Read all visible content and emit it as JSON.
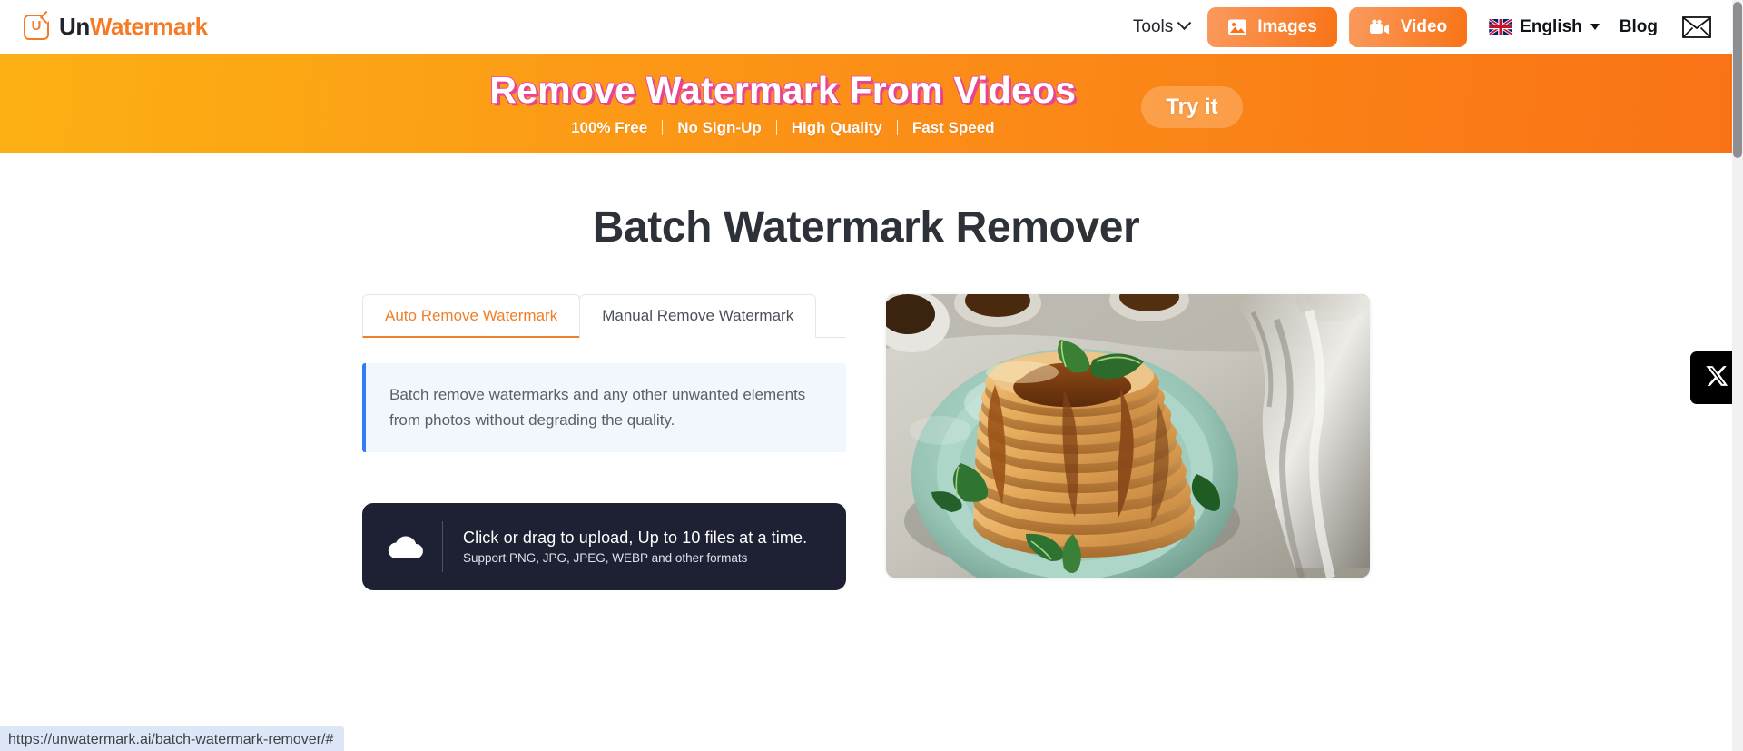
{
  "header": {
    "brand": {
      "prefix": "Un",
      "suffix": "Watermark",
      "mark_letter": "U",
      "icon": "logo-icon"
    },
    "tools_label": "Tools",
    "images_label": "Images",
    "video_label": "Video",
    "language_label": "English",
    "blog_label": "Blog",
    "mail_icon": "envelope-icon",
    "accent_orange": "#f97316",
    "brand_orange": "#f47b27"
  },
  "banner": {
    "title": "Remove Watermark From Videos",
    "features": [
      "100% Free",
      "No Sign-Up",
      "High Quality",
      "Fast Speed"
    ],
    "cta_label": "Try it",
    "gradient_start": "#fcb013",
    "gradient_end": "#f97316",
    "title_shadow_color": "#e8458f"
  },
  "main": {
    "page_title": "Batch Watermark Remover",
    "tabs": [
      {
        "label": "Auto Remove Watermark",
        "active": true
      },
      {
        "label": "Manual Remove Watermark",
        "active": false
      }
    ],
    "info_text": "Batch remove watermarks and any other unwanted elements from photos without degrading the quality.",
    "info_accent": "#2f7cf6",
    "upload": {
      "icon": "cloud-upload-icon",
      "primary": "Click or drag to upload, Up to 10 files at a time.",
      "secondary": "Support PNG, JPG, JPEG, WEBP and other formats",
      "background": "#1e2034"
    },
    "preview": {
      "alt": "stack of pancakes with syrup and mint on a teal plate",
      "plate_color": "#a7cfc4",
      "pancake_color": "#e8b162",
      "syrup_color": "#8a4318"
    }
  },
  "floating": {
    "x_social_label": "X",
    "x_social_icon": "x-twitter-icon"
  },
  "status_bar": {
    "url": "https://unwatermark.ai/batch-watermark-remover/#"
  }
}
